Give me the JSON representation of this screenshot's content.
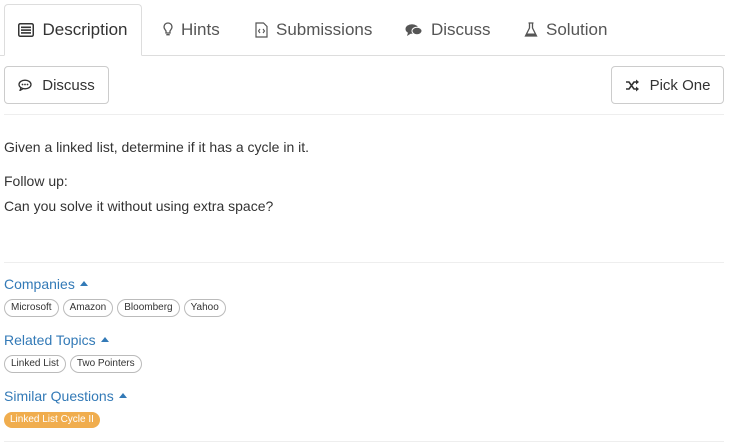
{
  "tabs": [
    {
      "label": "Description",
      "icon": "description-icon",
      "active": true
    },
    {
      "label": "Hints",
      "icon": "lightbulb-icon"
    },
    {
      "label": "Submissions",
      "icon": "code-file-icon"
    },
    {
      "label": "Discuss",
      "icon": "comments-icon"
    },
    {
      "label": "Solution",
      "icon": "flask-icon"
    }
  ],
  "toolbar": {
    "discuss_label": "Discuss",
    "pick_one_label": "Pick One"
  },
  "problem": {
    "statement": "Given a linked list, determine if it has a cycle in it.",
    "follow_up_title": "Follow up:",
    "follow_up_text": "Can you solve it without using extra space?"
  },
  "sections": {
    "companies": {
      "title": "Companies",
      "tags": [
        "Microsoft",
        "Amazon",
        "Bloomberg",
        "Yahoo"
      ]
    },
    "related_topics": {
      "title": "Related Topics",
      "tags": [
        "Linked List",
        "Two Pointers"
      ]
    },
    "similar_questions": {
      "title": "Similar Questions",
      "tags": [
        "Linked List Cycle II"
      ]
    }
  },
  "colors": {
    "link": "#337ab7",
    "tag_highlight": "#f0ad4e",
    "border": "#dddddd"
  }
}
